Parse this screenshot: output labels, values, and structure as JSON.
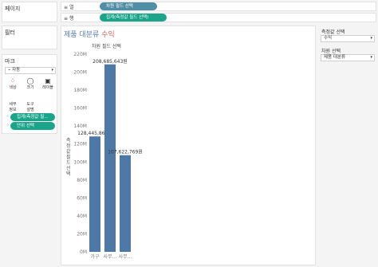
{
  "left": {
    "pages_title": "페이지",
    "filters_title": "필터",
    "marks_title": "마크",
    "mark_type": "자동",
    "mark_buttons": [
      {
        "label": "색상",
        "icon": "color-icon"
      },
      {
        "label": "크기",
        "icon": "size-icon"
      },
      {
        "label": "레이블",
        "icon": "label-icon"
      },
      {
        "label": "세부\n정보",
        "icon": "detail-icon"
      },
      {
        "label": "도구\n설명",
        "icon": "tooltip-icon"
      }
    ],
    "mark_pills": [
      "집계(측정값 필...",
      "단위 선택"
    ]
  },
  "shelves": {
    "columns_label": "열",
    "columns_pill": "차원 필드 선택",
    "rows_label": "행",
    "rows_pill": "집계(측정값 필드 선택)"
  },
  "view": {
    "title_part1": "제품 대분류",
    "title_part2": "수익",
    "header": "차원 필드 선택",
    "ylabel": "측정값 필드 선택"
  },
  "right": {
    "measure_title": "측정값 선택",
    "measure_value": "수익",
    "dimension_title": "차원 선택",
    "dimension_value": "제품 대분류"
  },
  "colors": {
    "bar": "#4e79a7",
    "title_blue": "#5b7fb5",
    "title_red": "#e05b5b",
    "pill_teal": "#1aa58a"
  },
  "chart_data": {
    "type": "bar",
    "categories": [
      "가구",
      "사무...",
      "사무..."
    ],
    "values": [
      128445865,
      208685643,
      107622769
    ],
    "data_labels": [
      "128,445,865원",
      "208,685,643원",
      "107,622,769원"
    ],
    "ylim": [
      0,
      220000000
    ],
    "yticks": [
      "0M",
      "20M",
      "40M",
      "60M",
      "80M",
      "100M",
      "120M",
      "140M",
      "160M",
      "180M",
      "200M",
      "220M"
    ],
    "ytick_values": [
      0,
      20000000,
      40000000,
      60000000,
      80000000,
      100000000,
      120000000,
      140000000,
      160000000,
      180000000,
      200000000,
      220000000
    ],
    "grid": false
  }
}
